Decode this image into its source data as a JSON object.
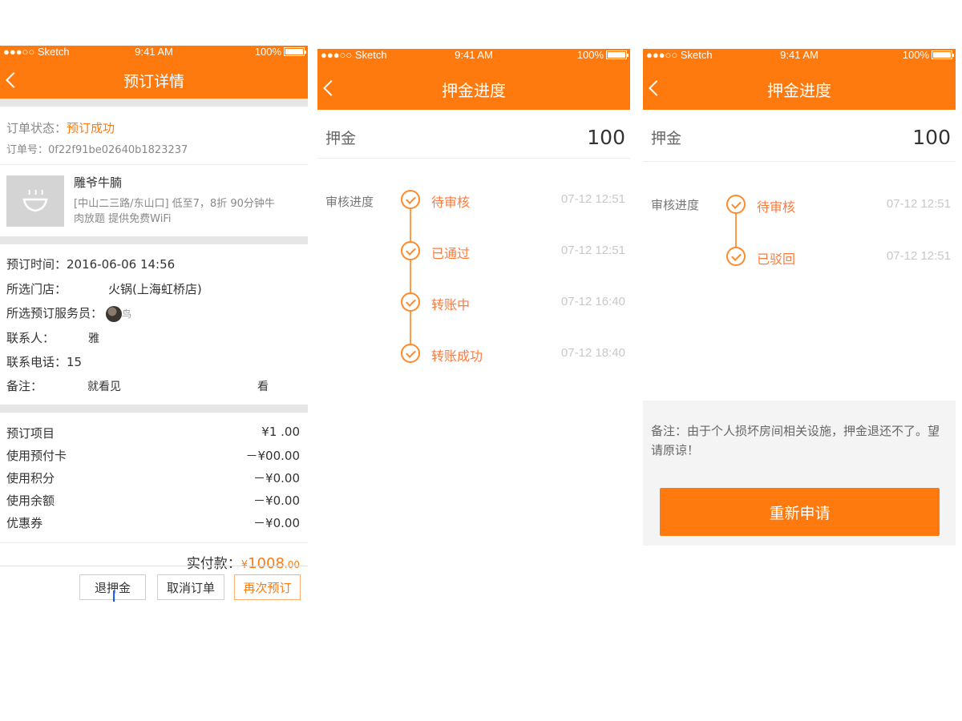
{
  "status_bar": {
    "carrier": "●●●○○ Sketch",
    "time": "9:41 AM",
    "battery": "100%"
  },
  "screen1": {
    "title": "预订详情",
    "order_status_label": "订单状态：",
    "order_status_value": "预订成功",
    "order_no": "订单号：0f22f91be02640b1823237",
    "item_name": "雕爷牛腩",
    "item_desc_line1": "[中山二三路/东山口] 低至7，8折 90分钟牛",
    "item_desc_line2": "肉放题 提供免费WiFi",
    "booking_time": "预订时间：2016-06-06 14:56",
    "store_label": "所选门店：",
    "store_value": "火锅(上海虹桥店)",
    "staff_label": "所选预订服务员：",
    "staff_value": "鸟",
    "contact_label": "联系人：",
    "contact_value": "雅",
    "phone": "联系电话：15",
    "remark_label": "备注：",
    "remark_value": "就看见",
    "remark_value2": "看",
    "prices": [
      {
        "label": "预订项目",
        "value": "¥1      .00"
      },
      {
        "label": "使用预付卡",
        "value": "－¥00.00"
      },
      {
        "label": "使用积分",
        "value": "－¥0.00"
      },
      {
        "label": "使用余额",
        "value": "－¥0.00"
      },
      {
        "label": "优惠券",
        "value": "－¥0.00"
      }
    ],
    "paid_label": "实付款：",
    "paid_currency": "¥",
    "paid_value": "1008",
    "paid_cents": ".00",
    "buttons": {
      "refund": "退押金",
      "cancel": "取消订单",
      "rebook": "再次预订"
    }
  },
  "screen2": {
    "title": "押金进度",
    "deposit_label": "押金",
    "deposit_value": "100",
    "progress_label": "审核进度",
    "steps": [
      {
        "text": "待审核",
        "time": "07-12 12:51"
      },
      {
        "text": "已通过",
        "time": "07-12 12:51"
      },
      {
        "text": "转账中",
        "time": "07-12 16:40"
      },
      {
        "text": "转账成功",
        "time": "07-12 18:40"
      }
    ]
  },
  "screen3": {
    "title": "押金进度",
    "deposit_label": "押金",
    "deposit_value": "100",
    "progress_label": "审核进度",
    "steps": [
      {
        "text": "待审核",
        "time": "07-12 12:51"
      },
      {
        "text": "已驳回",
        "time": "07-12 12:51"
      }
    ],
    "remark": "备注：由于个人损坏房间相关设施，押金退还不了。望请原谅！",
    "reapply": "重新申请"
  },
  "colors": {
    "accent": "#ff7a0e",
    "step": "#ff8a2a",
    "time": "#c8c8c8"
  },
  "icons": [
    "back-chevron-icon",
    "wifi-icon",
    "battery-icon",
    "check-circle-icon",
    "bowl-icon"
  ]
}
